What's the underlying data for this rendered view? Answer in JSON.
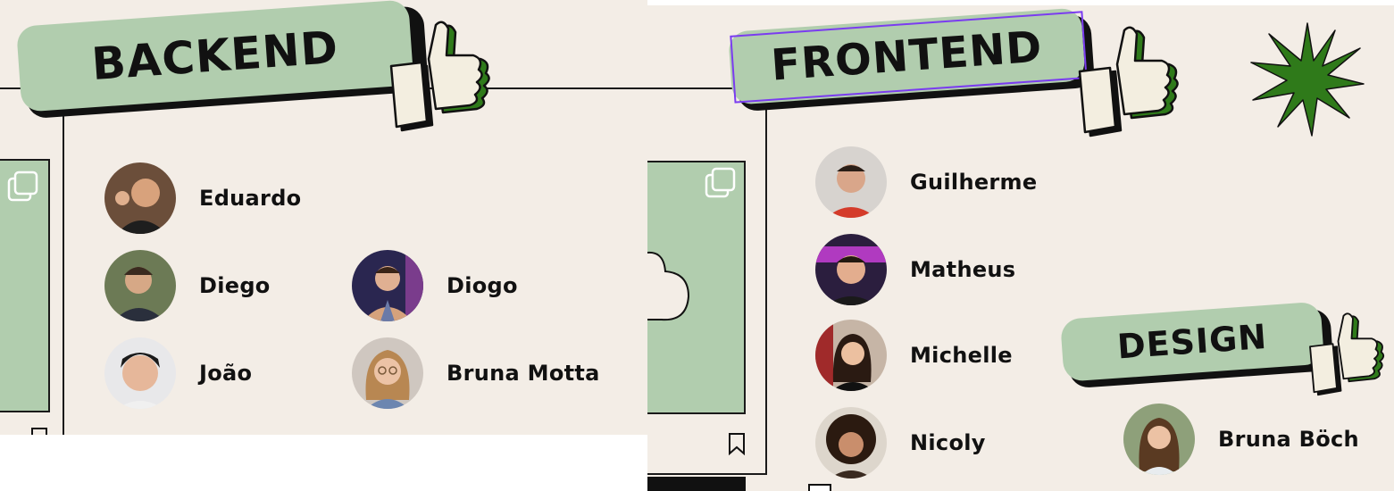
{
  "colors": {
    "panel_bg": "#f3ede6",
    "sage": "#b1cdae",
    "ink": "#111111",
    "accent_green": "#2f7a1a",
    "selection": "#7a3cf0"
  },
  "backend": {
    "title": "BACKEND",
    "members": [
      {
        "name": "Eduardo"
      },
      {
        "name": "Diego"
      },
      {
        "name": "Diogo"
      },
      {
        "name": "João"
      },
      {
        "name": "Bruna Motta"
      }
    ]
  },
  "frontend": {
    "title": "FRONTEND",
    "members": [
      {
        "name": "Guilherme"
      },
      {
        "name": "Matheus"
      },
      {
        "name": "Michelle"
      },
      {
        "name": "Nicoly"
      }
    ]
  },
  "design": {
    "title": "DESIGN",
    "members": [
      {
        "name": "Bruna Böch"
      }
    ]
  },
  "icons": [
    "thumbs-up-icon",
    "copy-icon",
    "bookmark-icon",
    "star-burst-icon",
    "cloud-icon"
  ]
}
